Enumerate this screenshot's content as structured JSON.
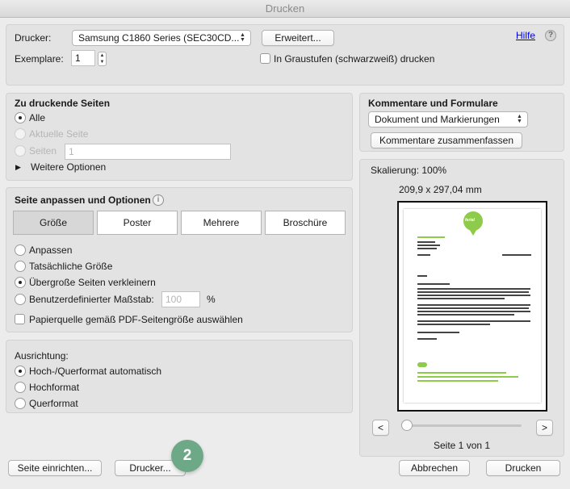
{
  "window": {
    "title": "Drucken"
  },
  "printer": {
    "label": "Drucker:",
    "selected": "Samsung C1860 Series (SEC30CD...",
    "advanced_button": "Erweitert...",
    "help_link": "Hilfe",
    "help_icon": "?",
    "copies_label": "Exemplare:",
    "copies_value": "1",
    "grayscale_label": "In Graustufen (schwarzweiß) drucken"
  },
  "pages": {
    "title": "Zu druckende Seiten",
    "all": "Alle",
    "current": "Aktuelle Seite",
    "range_label": "Seiten",
    "range_value": "1",
    "more_options": "Weitere Optionen"
  },
  "fit": {
    "title": "Seite anpassen und Optionen",
    "info_icon": "i",
    "tabs": [
      "Größe",
      "Poster",
      "Mehrere",
      "Broschüre"
    ],
    "options": {
      "fit": "Anpassen",
      "actual": "Tatsächliche Größe",
      "shrink": "Übergroße Seiten verkleinern",
      "custom": "Benutzerdefinierter Maßstab:"
    },
    "custom_value": "100",
    "percent": "%",
    "paper_source": "Papierquelle gemäß PDF-Seitengröße auswählen"
  },
  "orientation": {
    "title": "Ausrichtung:",
    "auto": "Hoch-/Querformat automatisch",
    "portrait": "Hochformat",
    "landscape": "Querformat"
  },
  "comments": {
    "title": "Kommentare und Formulare",
    "selected": "Dokument und Markierungen",
    "summarize_button": "Kommentare zusammenfassen"
  },
  "preview": {
    "scaling": "Skalierung: 100%",
    "dimensions": "209,9 x 297,04 mm",
    "logo_text": "ferial",
    "prev": "<",
    "next": ">",
    "page_counter": "Seite 1 von 1"
  },
  "footer": {
    "page_setup": "Seite einrichten...",
    "printer_button": "Drucker...",
    "badge": "2",
    "cancel": "Abbrechen",
    "print": "Drucken"
  },
  "colors": {
    "badge": "#6ea987",
    "logo": "#8ecb4a"
  }
}
